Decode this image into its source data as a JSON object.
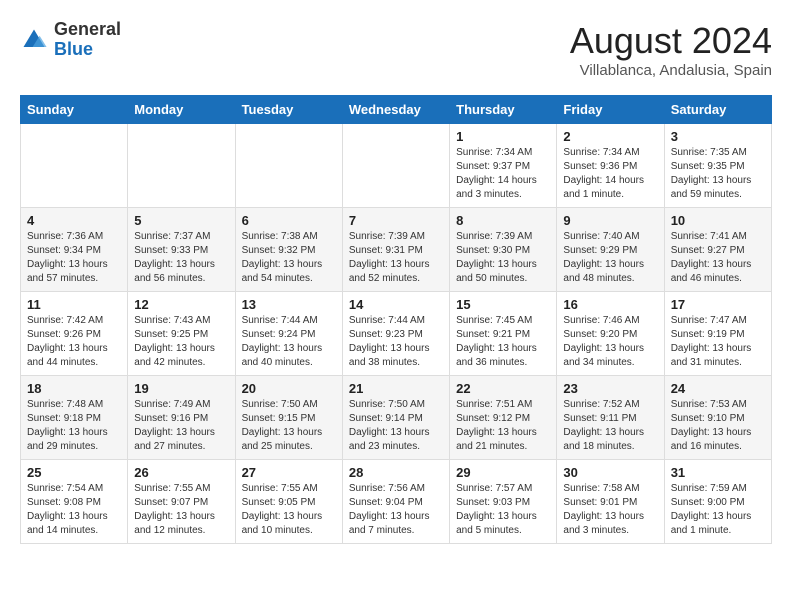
{
  "header": {
    "logo_general": "General",
    "logo_blue": "Blue",
    "month_year": "August 2024",
    "location": "Villablanca, Andalusia, Spain"
  },
  "weekdays": [
    "Sunday",
    "Monday",
    "Tuesday",
    "Wednesday",
    "Thursday",
    "Friday",
    "Saturday"
  ],
  "weeks": [
    [
      {
        "day": "",
        "info": ""
      },
      {
        "day": "",
        "info": ""
      },
      {
        "day": "",
        "info": ""
      },
      {
        "day": "",
        "info": ""
      },
      {
        "day": "1",
        "info": "Sunrise: 7:34 AM\nSunset: 9:37 PM\nDaylight: 14 hours\nand 3 minutes."
      },
      {
        "day": "2",
        "info": "Sunrise: 7:34 AM\nSunset: 9:36 PM\nDaylight: 14 hours\nand 1 minute."
      },
      {
        "day": "3",
        "info": "Sunrise: 7:35 AM\nSunset: 9:35 PM\nDaylight: 13 hours\nand 59 minutes."
      }
    ],
    [
      {
        "day": "4",
        "info": "Sunrise: 7:36 AM\nSunset: 9:34 PM\nDaylight: 13 hours\nand 57 minutes."
      },
      {
        "day": "5",
        "info": "Sunrise: 7:37 AM\nSunset: 9:33 PM\nDaylight: 13 hours\nand 56 minutes."
      },
      {
        "day": "6",
        "info": "Sunrise: 7:38 AM\nSunset: 9:32 PM\nDaylight: 13 hours\nand 54 minutes."
      },
      {
        "day": "7",
        "info": "Sunrise: 7:39 AM\nSunset: 9:31 PM\nDaylight: 13 hours\nand 52 minutes."
      },
      {
        "day": "8",
        "info": "Sunrise: 7:39 AM\nSunset: 9:30 PM\nDaylight: 13 hours\nand 50 minutes."
      },
      {
        "day": "9",
        "info": "Sunrise: 7:40 AM\nSunset: 9:29 PM\nDaylight: 13 hours\nand 48 minutes."
      },
      {
        "day": "10",
        "info": "Sunrise: 7:41 AM\nSunset: 9:27 PM\nDaylight: 13 hours\nand 46 minutes."
      }
    ],
    [
      {
        "day": "11",
        "info": "Sunrise: 7:42 AM\nSunset: 9:26 PM\nDaylight: 13 hours\nand 44 minutes."
      },
      {
        "day": "12",
        "info": "Sunrise: 7:43 AM\nSunset: 9:25 PM\nDaylight: 13 hours\nand 42 minutes."
      },
      {
        "day": "13",
        "info": "Sunrise: 7:44 AM\nSunset: 9:24 PM\nDaylight: 13 hours\nand 40 minutes."
      },
      {
        "day": "14",
        "info": "Sunrise: 7:44 AM\nSunset: 9:23 PM\nDaylight: 13 hours\nand 38 minutes."
      },
      {
        "day": "15",
        "info": "Sunrise: 7:45 AM\nSunset: 9:21 PM\nDaylight: 13 hours\nand 36 minutes."
      },
      {
        "day": "16",
        "info": "Sunrise: 7:46 AM\nSunset: 9:20 PM\nDaylight: 13 hours\nand 34 minutes."
      },
      {
        "day": "17",
        "info": "Sunrise: 7:47 AM\nSunset: 9:19 PM\nDaylight: 13 hours\nand 31 minutes."
      }
    ],
    [
      {
        "day": "18",
        "info": "Sunrise: 7:48 AM\nSunset: 9:18 PM\nDaylight: 13 hours\nand 29 minutes."
      },
      {
        "day": "19",
        "info": "Sunrise: 7:49 AM\nSunset: 9:16 PM\nDaylight: 13 hours\nand 27 minutes."
      },
      {
        "day": "20",
        "info": "Sunrise: 7:50 AM\nSunset: 9:15 PM\nDaylight: 13 hours\nand 25 minutes."
      },
      {
        "day": "21",
        "info": "Sunrise: 7:50 AM\nSunset: 9:14 PM\nDaylight: 13 hours\nand 23 minutes."
      },
      {
        "day": "22",
        "info": "Sunrise: 7:51 AM\nSunset: 9:12 PM\nDaylight: 13 hours\nand 21 minutes."
      },
      {
        "day": "23",
        "info": "Sunrise: 7:52 AM\nSunset: 9:11 PM\nDaylight: 13 hours\nand 18 minutes."
      },
      {
        "day": "24",
        "info": "Sunrise: 7:53 AM\nSunset: 9:10 PM\nDaylight: 13 hours\nand 16 minutes."
      }
    ],
    [
      {
        "day": "25",
        "info": "Sunrise: 7:54 AM\nSunset: 9:08 PM\nDaylight: 13 hours\nand 14 minutes."
      },
      {
        "day": "26",
        "info": "Sunrise: 7:55 AM\nSunset: 9:07 PM\nDaylight: 13 hours\nand 12 minutes."
      },
      {
        "day": "27",
        "info": "Sunrise: 7:55 AM\nSunset: 9:05 PM\nDaylight: 13 hours\nand 10 minutes."
      },
      {
        "day": "28",
        "info": "Sunrise: 7:56 AM\nSunset: 9:04 PM\nDaylight: 13 hours\nand 7 minutes."
      },
      {
        "day": "29",
        "info": "Sunrise: 7:57 AM\nSunset: 9:03 PM\nDaylight: 13 hours\nand 5 minutes."
      },
      {
        "day": "30",
        "info": "Sunrise: 7:58 AM\nSunset: 9:01 PM\nDaylight: 13 hours\nand 3 minutes."
      },
      {
        "day": "31",
        "info": "Sunrise: 7:59 AM\nSunset: 9:00 PM\nDaylight: 13 hours\nand 1 minute."
      }
    ]
  ]
}
